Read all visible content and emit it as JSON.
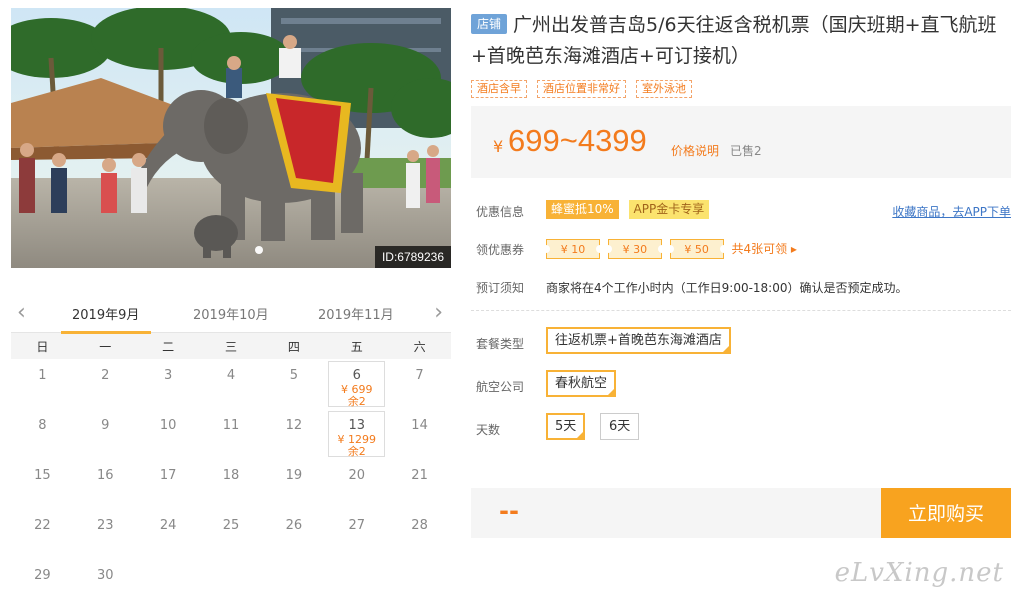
{
  "photo": {
    "id_label": "ID:6789236"
  },
  "calendar": {
    "months": [
      "2019年9月",
      "2019年10月",
      "2019年11月"
    ],
    "weekdays": [
      "日",
      "一",
      "二",
      "三",
      "四",
      "五",
      "六"
    ],
    "days": [
      {
        "d": "1"
      },
      {
        "d": "2"
      },
      {
        "d": "3"
      },
      {
        "d": "4"
      },
      {
        "d": "5"
      },
      {
        "d": "6",
        "price": "¥ 699",
        "left": "余2"
      },
      {
        "d": "7"
      },
      {
        "d": "8"
      },
      {
        "d": "9"
      },
      {
        "d": "10"
      },
      {
        "d": "11"
      },
      {
        "d": "12"
      },
      {
        "d": "13",
        "price": "¥ 1299",
        "left": "余2"
      },
      {
        "d": "14"
      },
      {
        "d": "15"
      },
      {
        "d": "16"
      },
      {
        "d": "17"
      },
      {
        "d": "18"
      },
      {
        "d": "19"
      },
      {
        "d": "20"
      },
      {
        "d": "21"
      },
      {
        "d": "22"
      },
      {
        "d": "23"
      },
      {
        "d": "24"
      },
      {
        "d": "25"
      },
      {
        "d": "26"
      },
      {
        "d": "27"
      },
      {
        "d": "28"
      },
      {
        "d": "29"
      },
      {
        "d": "30"
      }
    ]
  },
  "product": {
    "shop_tag": "店铺",
    "title": "广州出发普吉岛5/6天往返含税机票（国庆班期+直飞航班+首晚芭东海滩酒店+可订接机）",
    "tags": [
      "酒店含早",
      "酒店位置非常好",
      "室外泳池"
    ],
    "price_symbol": "¥",
    "price_range": "699~4399",
    "price_note": "价格说明",
    "sold": "已售2"
  },
  "offers": {
    "label": "优惠信息",
    "chip1": "蜂蜜抵10%",
    "chip2": "APP金卡专享",
    "fav_link": "收藏商品，去APP下单"
  },
  "coupons": {
    "label": "领优惠券",
    "items": [
      "¥ 10",
      "¥ 30",
      "¥ 50"
    ],
    "more": "共4张可领 ▸"
  },
  "booking": {
    "label": "预订须知",
    "text": "商家将在4个工作小时内（工作日9:00-18:00）确认是否预定成功。"
  },
  "options": {
    "package_label": "套餐类型",
    "package_value": "往返机票+首晚芭东海滩酒店",
    "airline_label": "航空公司",
    "airline_value": "春秋航空",
    "days_label": "天数",
    "days_values": [
      "5天",
      "6天"
    ]
  },
  "buy": {
    "dash": "--",
    "button": "立即购买"
  },
  "watermark": "eLvXing.net"
}
